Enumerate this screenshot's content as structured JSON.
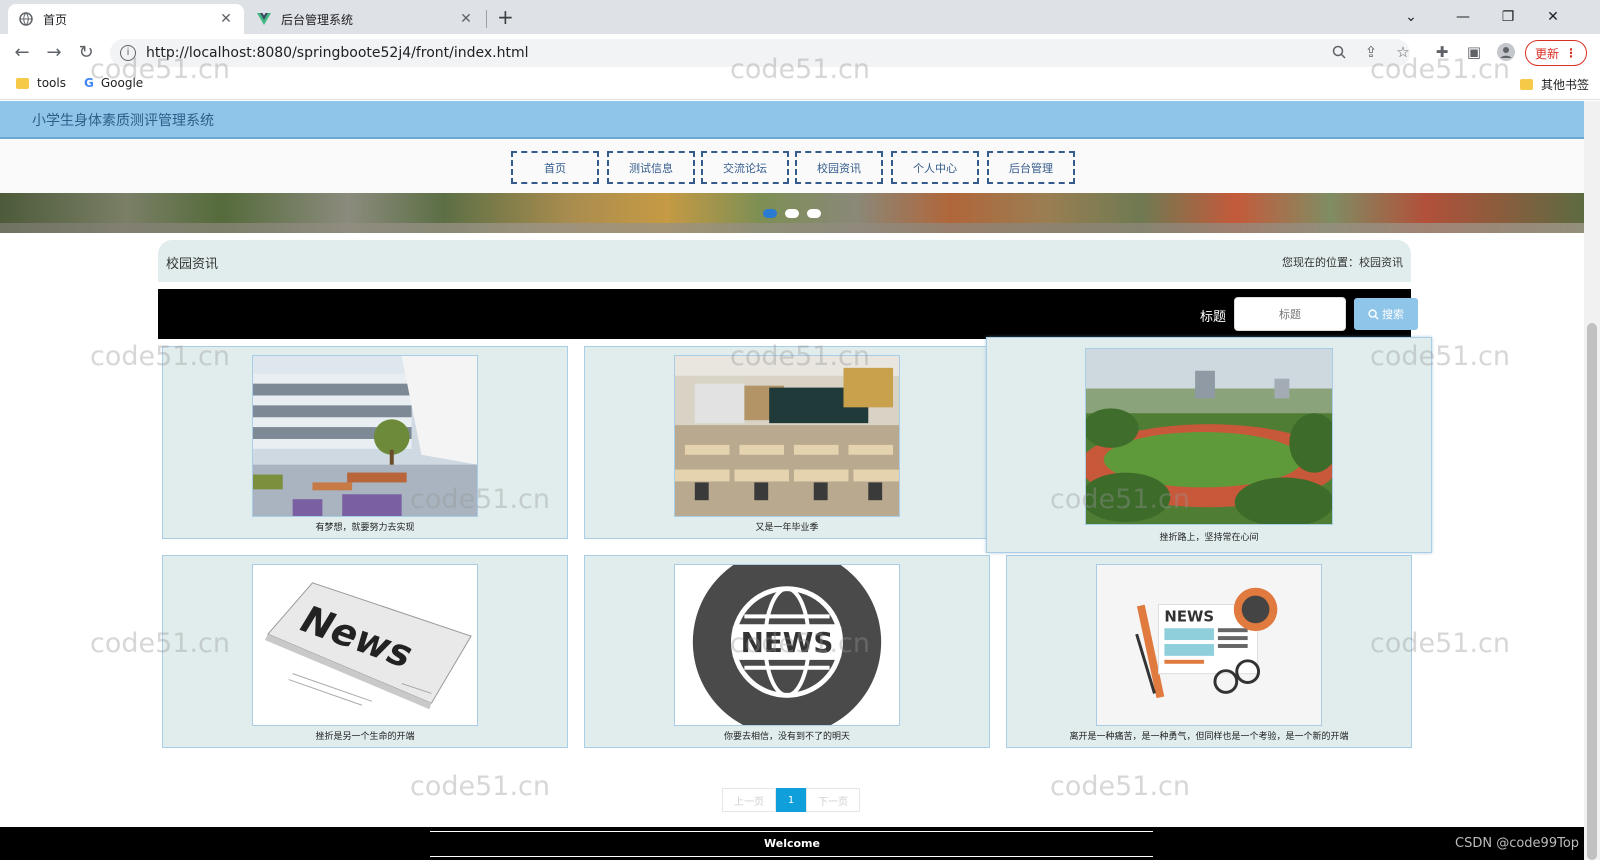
{
  "browser": {
    "tabs": [
      {
        "title": "首页",
        "icon": "globe-icon",
        "active": true
      },
      {
        "title": "后台管理系统",
        "icon": "vue-logo-icon",
        "active": false
      }
    ],
    "url": "http://localhost:8080/springboote52j4/front/index.html",
    "update_label": "更新",
    "bookmarks": [
      {
        "label": "tools",
        "icon": "folder-icon"
      },
      {
        "label": "Google",
        "icon": "google-icon"
      }
    ],
    "other_bookmarks": "其他书签"
  },
  "site": {
    "name": "小学生身体素质测评管理系统",
    "menu": [
      "首页",
      "测试信息",
      "交流论坛",
      "校园资讯",
      "个人中心",
      "后台管理"
    ],
    "carousel": {
      "dots": 3,
      "active": 0,
      "colors": {
        "active": "#2a7bd1",
        "inactive": "#ffffff"
      }
    }
  },
  "section": {
    "title": "校园资讯",
    "location": "您现在的位置：校园资讯"
  },
  "search": {
    "label": "标题",
    "placeholder": "标题",
    "button": "搜索"
  },
  "news": [
    {
      "caption": "有梦想，就要努力去实现",
      "image": "modern-school-courtyard"
    },
    {
      "caption": "又是一年毕业季",
      "image": "classroom"
    },
    {
      "caption": "挫折路上，坚持常在心间",
      "image": "running-track-field"
    },
    {
      "caption": "挫折是另一个生命的开端",
      "image": "newspaper-news"
    },
    {
      "caption": "你要去相信，没有到不了的明天",
      "image": "globe-news-badge"
    },
    {
      "caption": "离开是一种痛苦，是一种勇气，但同样也是一个考验，是一个新的开端",
      "image": "news-illustration"
    }
  ],
  "pagination": {
    "prev": "上一页",
    "current": "1",
    "next": "下一页"
  },
  "footer": {
    "text": "Welcome"
  },
  "watermark": "code51.cn",
  "csdn_credit": "CSDN @code99Top",
  "colors": {
    "site_header": "#8ec5e8",
    "menu_border": "#345b8c",
    "panel_bg": "#e1eded",
    "page_active": "#0fa0dc"
  }
}
